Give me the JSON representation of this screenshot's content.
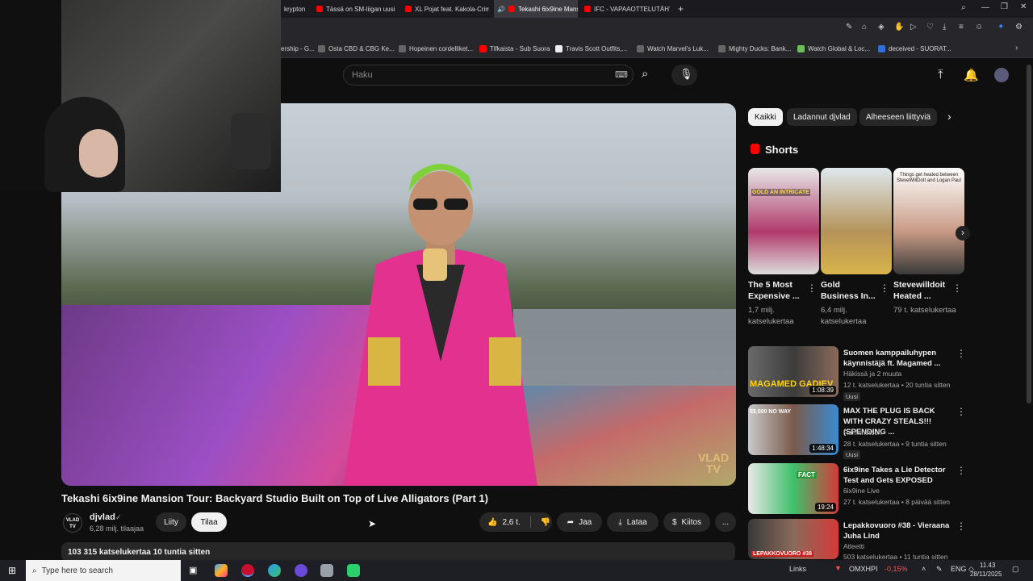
{
  "browser": {
    "tabs": [
      {
        "label": "krypton"
      },
      {
        "label": "Tässä on SM-liigan uusi s"
      },
      {
        "label": "XL Pojat feat. Kakola-Crim"
      },
      {
        "label": "Tekashi 6ix9ine Mansi"
      },
      {
        "label": "IFC - VAPAAOTTELUTÄHTI"
      }
    ],
    "new_tab": "+",
    "bookmarks": [
      {
        "label": "ership - G..."
      },
      {
        "label": "Osta CBD & CBG Ke..."
      },
      {
        "label": "Hopeinen cordelliket..."
      },
      {
        "label": "Tifkaista - Sub Suora"
      },
      {
        "label": "Travis Scott Outfits,..."
      },
      {
        "label": "Watch Marvel's Luk..."
      },
      {
        "label": "Mighty Ducks: Bank..."
      },
      {
        "label": "Watch Global & Loc..."
      },
      {
        "label": "deceived - SUORAT..."
      }
    ]
  },
  "header": {
    "search_placeholder": "Haku"
  },
  "video": {
    "title": "Tekashi 6ix9ine Mansion Tour: Backyard Studio Built on Top of Live Alligators (Part 1)",
    "watermark": "VLAD TV",
    "channel": {
      "name": "djvlad",
      "subscribers": "6,28 milj. tilaajaa",
      "avatar_text": "VLAD TV"
    },
    "join_label": "Liity",
    "subscribe_label": "Tilaa",
    "likes": "2,6 t.",
    "share_label": "Jaa",
    "download_label": "Lataa",
    "thanks_label": "Kiitos",
    "more": "...",
    "description": "103 315 katselukertaa  10 tuntia sitten"
  },
  "sidebar": {
    "chips": [
      "Kaikki",
      "Ladannut djvlad",
      "Alheeseen liittyviä"
    ],
    "shorts_heading": "Shorts",
    "shorts": [
      {
        "title": "The 5 Most Expensive ...",
        "views": "1,7 milj. katselukertaa",
        "thumb_text": "GOLD AN INTRICATE"
      },
      {
        "title": "Gold Business In...",
        "views": "6,4 milj. katselukertaa",
        "thumb_text": ""
      },
      {
        "title": "Stevewilldoit Heated ...",
        "views": "79 t. katselukertaa",
        "thumb_text": "Things get heated between SteveWillDoIt and Logan Paul"
      }
    ],
    "videos": [
      {
        "title": "Suomen kamppailuhypen käynnistäjä ft. Magamed ...",
        "channel": "Häkissä ja 2 muuta",
        "meta": "12 t. katselukertaa • 20 tuntia sitten",
        "badge": "Uusi",
        "duration": "1:08:39",
        "thumb_text": "MAGAMED GADIEV"
      },
      {
        "title": "MAX THE PLUG IS BACK WITH CRAZY STEALS!!! (SPENDING ...",
        "channel": "Ramithetcon",
        "meta": "28 t. katselukertaa • 9 tuntia sitten",
        "badge": "Uusi",
        "duration": "1:48:34",
        "thumb_text": "$5,000  NO WAY"
      },
      {
        "title": "6ix9ine Takes a Lie Detector Test and Gets EXPOSED",
        "channel": "6ix9ine Live",
        "meta": "27 t. katselukertaa • 8 päivää sitten",
        "badge": "",
        "duration": "19:24",
        "thumb_text": "FACT"
      },
      {
        "title": "Lepakkovuoro #38 - Vieraana Juha Lind",
        "channel": "Atleetti",
        "meta": "503 katselukertaa • 11 tuntia sitten",
        "badge": "",
        "duration": "",
        "thumb_text": "LEPAKKOVUORO #38"
      }
    ]
  },
  "taskbar": {
    "search_placeholder": "Type here to search",
    "links": "Links",
    "ticker_name": "OMXHPI",
    "ticker_change": "-0,15%",
    "lang": "ENG",
    "time": "11.43",
    "date": "28/11/2025"
  },
  "colors": {
    "background": "#0f0f0f",
    "accent_red": "#ff0000",
    "chip_active": "#f1f1f1",
    "ticker_down": "#ff4d4d"
  }
}
